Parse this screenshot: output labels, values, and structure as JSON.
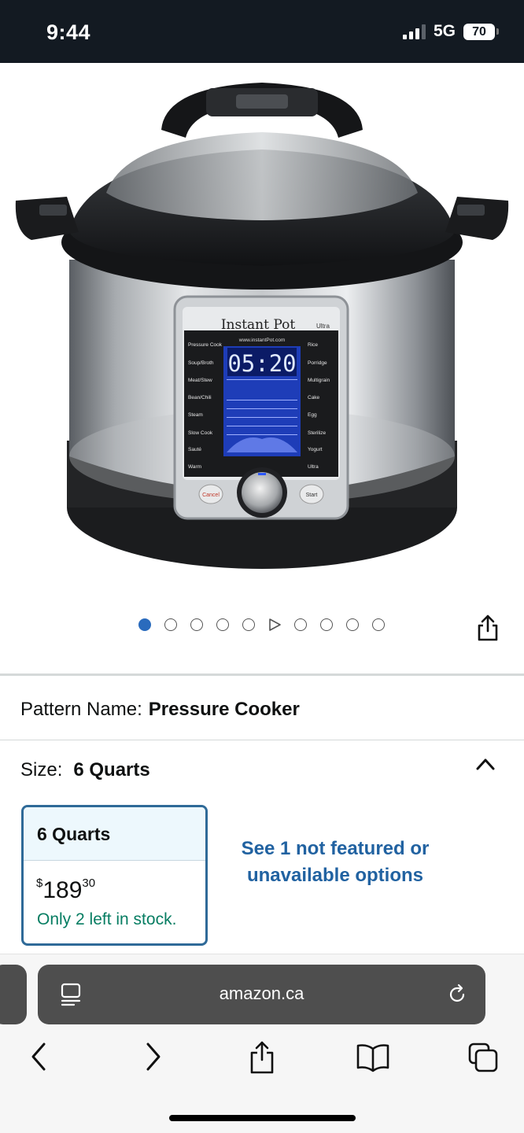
{
  "status": {
    "time": "9:44",
    "network": "5G",
    "battery": "70"
  },
  "carousel": {
    "count": 10,
    "active_index": 0,
    "video_index": 5
  },
  "product": {
    "display": {
      "brand": "Instant Pot",
      "model": "Ultra",
      "website": "www.instantPot.com",
      "time": "05:20",
      "left_buttons": [
        "Pressure Cook",
        "Soup/Broth",
        "Meat/Stew",
        "Bean/Chili",
        "Steam",
        "Slow Cook",
        "Sauté",
        "Warm"
      ],
      "right_buttons": [
        "Rice",
        "Porridge",
        "Multigrain",
        "Cake",
        "Egg",
        "Sterilize",
        "Yogurt",
        "Ultra"
      ],
      "cancel": "Cancel",
      "start": "Start"
    }
  },
  "pattern": {
    "label": "Pattern Name:",
    "value": "Pressure Cooker"
  },
  "size": {
    "label": "Size:",
    "value": "6 Quarts"
  },
  "option": {
    "name": "6 Quarts",
    "currency": "$",
    "price_whole": "189",
    "price_cents": "30",
    "stock": "Only 2 left in stock."
  },
  "see_more": "See 1 not featured or unavailable options",
  "browser": {
    "url": "amazon.ca"
  },
  "colors": {
    "accent": "#2a6bbd",
    "option_border": "#2f6a98",
    "stock": "#067d62",
    "link": "#2162a1"
  }
}
